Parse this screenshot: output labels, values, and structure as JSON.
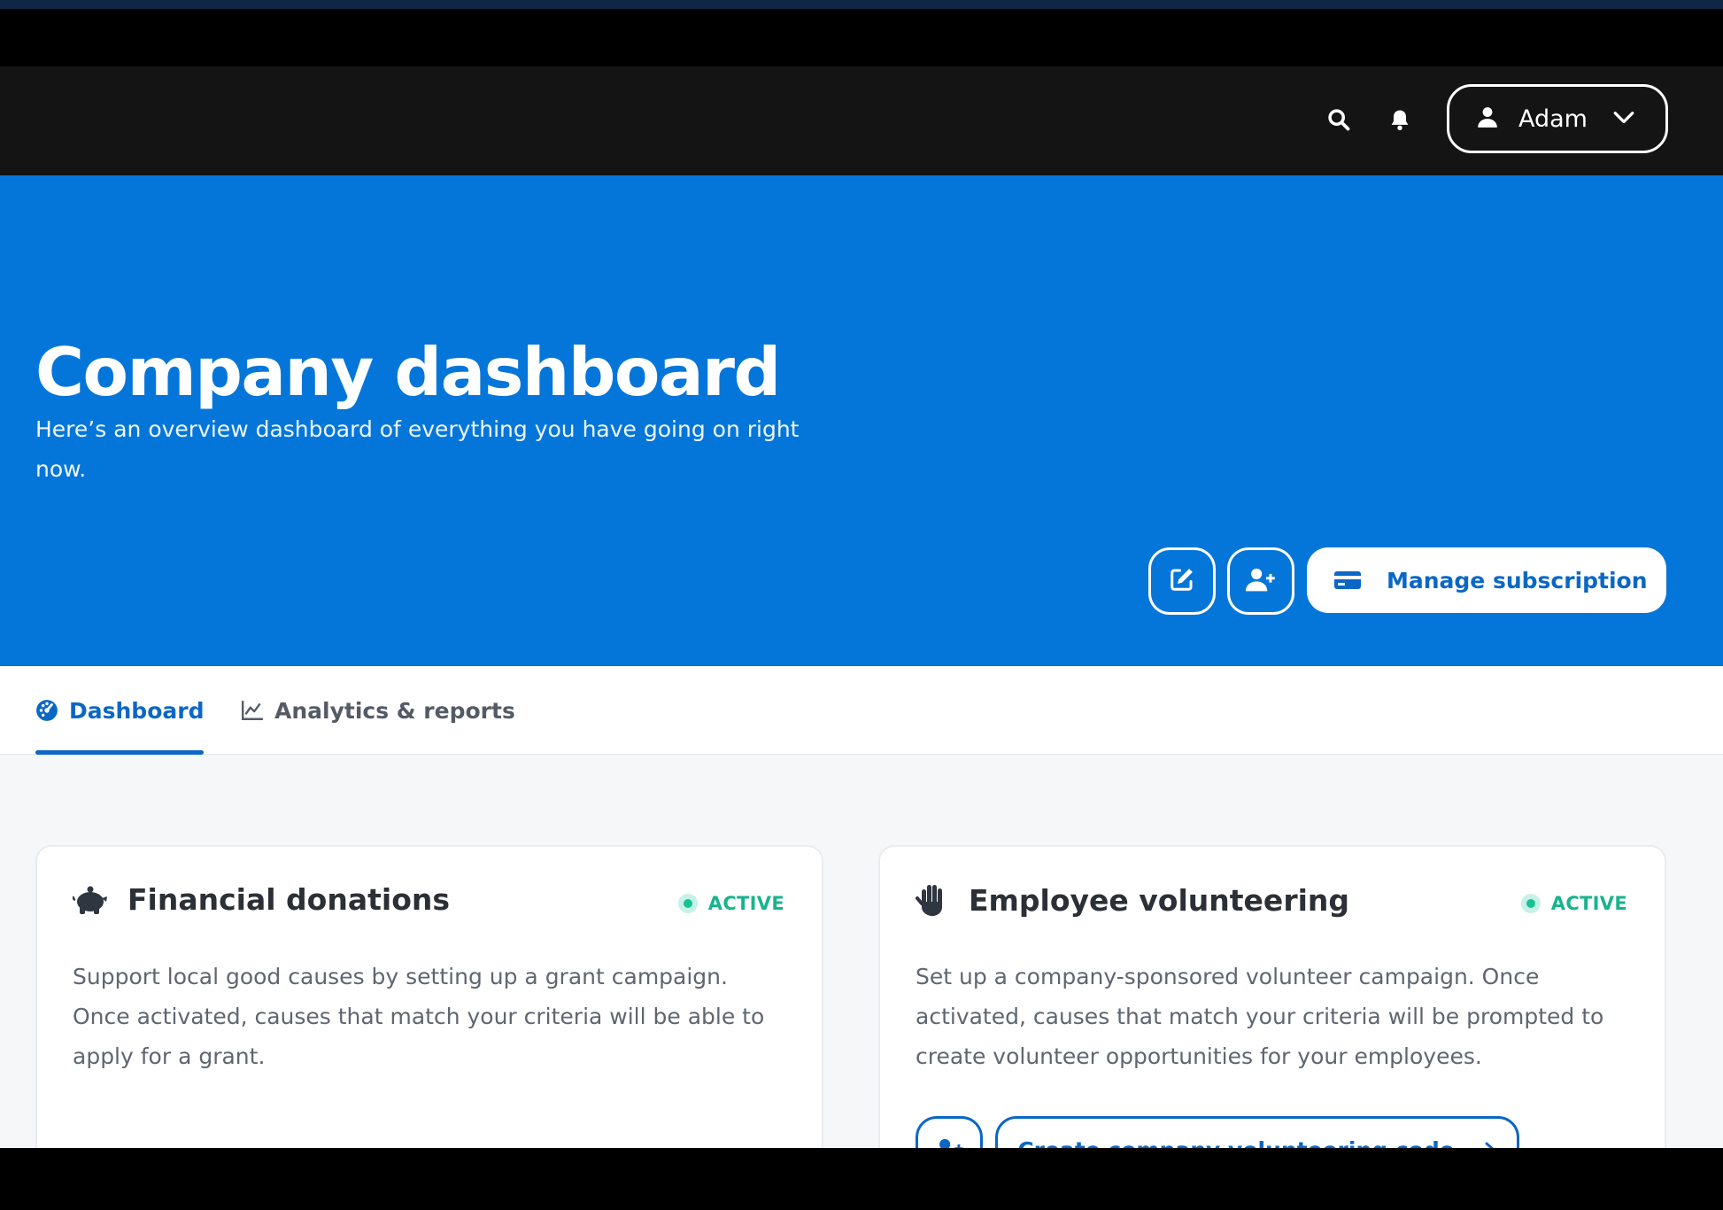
{
  "header": {
    "user_name": "Adam"
  },
  "hero": {
    "title": "Company dashboard",
    "subtitle": "Here’s an overview dashboard of everything you have going on right now.",
    "manage_label": "Manage subscription"
  },
  "tabs": [
    {
      "label": "Dashboard",
      "active": true
    },
    {
      "label": "Analytics & reports",
      "active": false
    }
  ],
  "cards": [
    {
      "title": "Financial donations",
      "status": "ACTIVE",
      "description": "Support local good causes by setting up a grant campaign. Once activated, causes that match your criteria will be able to apply for a grant."
    },
    {
      "title": "Employee volunteering",
      "status": "ACTIVE",
      "description": "Set up a company-sponsored volunteer campaign. Once activated, causes that match your criteria will be prompted to create volunteer opportunities for your employees.",
      "cta_label": "Create company volunteering code"
    }
  ],
  "colors": {
    "brand_blue": "#0576D9",
    "active_green": "#18B48D",
    "header_bg": "#141414"
  }
}
